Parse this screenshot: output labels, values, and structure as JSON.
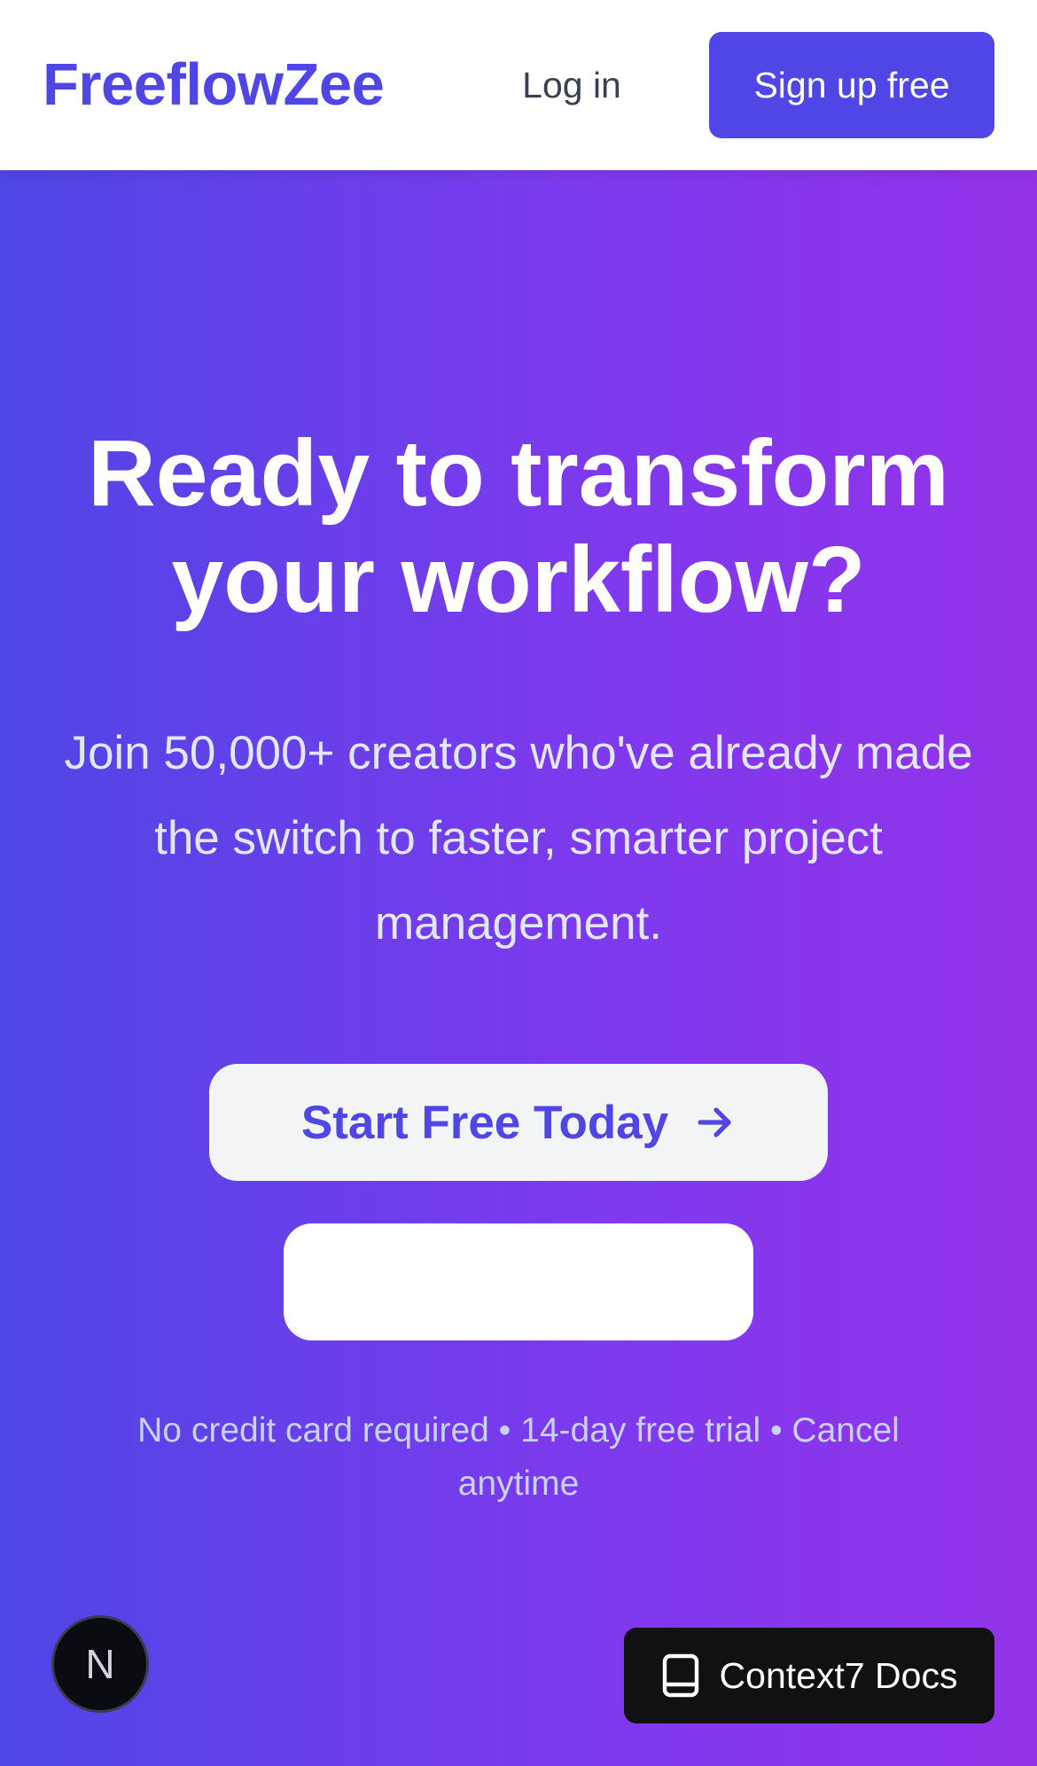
{
  "header": {
    "brand": "FreeflowZee",
    "login_label": "Log in",
    "signup_label": "Sign up free"
  },
  "hero": {
    "title": "Ready to transform your workflow?",
    "subtitle": "Join 50,000+ creators who've already made the switch to faster, smarter project management.",
    "cta_primary_label": "Start Free Today",
    "cta_primary_icon": "arrow-right-icon",
    "cta_secondary_label": "",
    "fineprint": "No credit card required • 14-day free trial • Cancel anytime"
  },
  "widgets": {
    "next_badge_label": "N",
    "docs_label": "Context7 Docs",
    "docs_icon": "book-icon"
  },
  "colors": {
    "brand": "#4f46e5",
    "gradient_start": "#4f46e5",
    "gradient_end": "#9333ea",
    "cta_bg": "#f3f4f6"
  }
}
